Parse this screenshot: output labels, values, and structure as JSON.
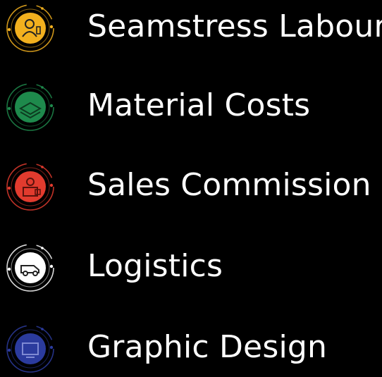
{
  "items": [
    {
      "label": "Seamstress Labour",
      "color": "#F2B01E",
      "icon": "seamstress-icon"
    },
    {
      "label": "Material Costs",
      "color": "#1E8A4C",
      "icon": "fabric-stack-icon"
    },
    {
      "label": "Sales Commission",
      "color": "#E23B2E",
      "icon": "salesperson-icon"
    },
    {
      "label": "Logistics",
      "color": "#FFFFFF",
      "icon": "delivery-van-icon"
    },
    {
      "label": "Graphic Design",
      "color": "#2B3B9E",
      "icon": "design-tools-icon"
    }
  ]
}
